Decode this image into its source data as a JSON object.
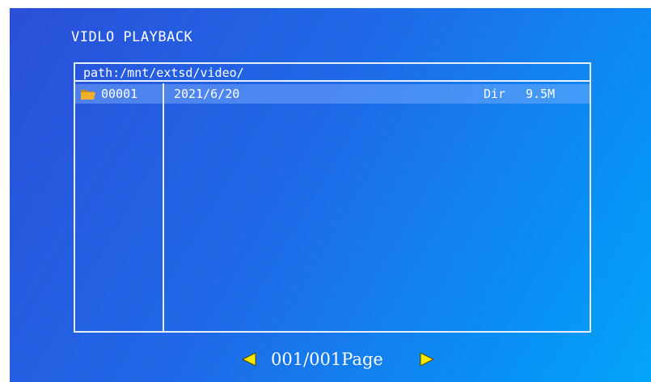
{
  "header": {
    "title": "VIDLO PLAYBACK"
  },
  "browser": {
    "path": "path:/mnt/extsd/video/",
    "rows": [
      {
        "icon": "folder-icon",
        "name": "00001",
        "date": "2021/6/20",
        "type": "Dir",
        "size": "9.5M",
        "selected": true
      }
    ]
  },
  "pager": {
    "text": "001/001Page",
    "prev_icon": "left-arrow-icon",
    "next_icon": "right-arrow-icon"
  },
  "colors": {
    "background_start": "#2a4fd9",
    "background_end": "#03a4f8",
    "border": "#e6eeff",
    "selection": "#82b4ff",
    "arrow": "#ffe600",
    "folder": "#f0b02c"
  }
}
